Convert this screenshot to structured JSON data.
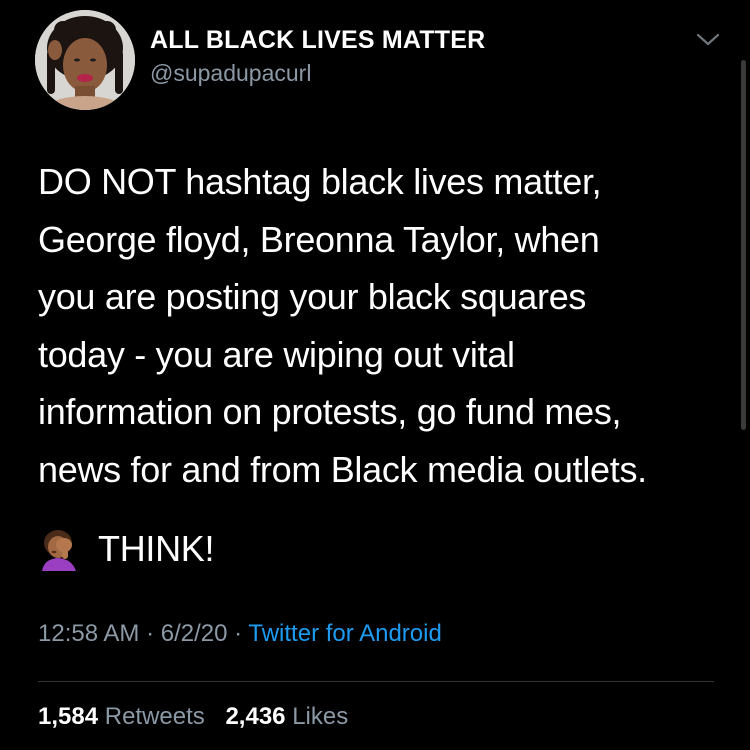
{
  "user": {
    "display_name": "ALL BLACK LIVES MATTER",
    "handle": "@supadupacurl"
  },
  "tweet": {
    "body": "DO NOT hashtag black lives matter,\nGeorge floyd, Breonna Taylor, when\nyou are posting your black squares\ntoday - you are wiping out vital\ninformation on protests, go fund mes,\nnews for and from Black media outlets.",
    "think_emoji_icon": "person-facepalming-icon",
    "think_text": "THINK!",
    "time": "12:58 AM",
    "date": "6/2/20",
    "separator": "·",
    "source": "Twitter for Android"
  },
  "stats": {
    "retweets_count": "1,584",
    "retweets_label": "Retweets",
    "likes_count": "2,436",
    "likes_label": "Likes"
  },
  "colors": {
    "background": "#000000",
    "text": "#ffffff",
    "secondary": "#8b98a5",
    "link": "#1d9bf0"
  }
}
